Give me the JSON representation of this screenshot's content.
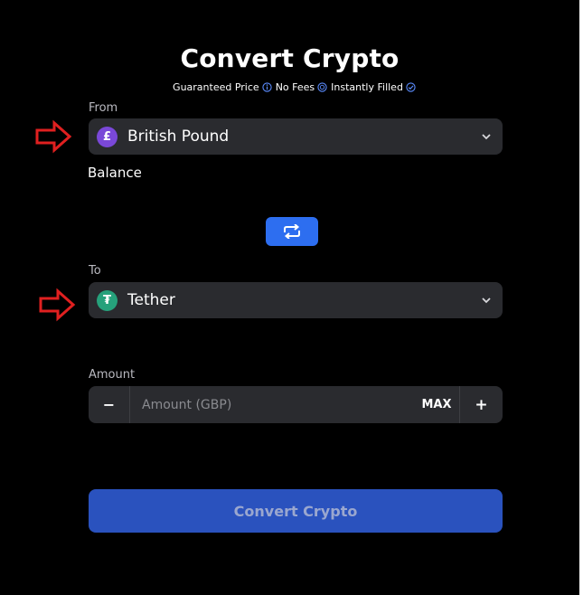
{
  "page": {
    "title": "Convert Crypto"
  },
  "features": [
    {
      "label": "Guaranteed Price",
      "icon": "info-circle-icon"
    },
    {
      "label": "No Fees",
      "icon": "coin-circle-icon"
    },
    {
      "label": "Instantly Filled",
      "icon": "check-circle-icon"
    }
  ],
  "from": {
    "label": "From",
    "currency": "British Pound",
    "icon_glyph": "£",
    "icon": "pound-coin-icon",
    "balance_label": "Balance"
  },
  "swap": {
    "icon": "swap-arrows-icon"
  },
  "to": {
    "label": "To",
    "currency": "Tether",
    "icon_glyph": "₮",
    "icon": "tether-coin-icon"
  },
  "amount": {
    "label": "Amount",
    "decrement": "−",
    "placeholder": "Amount (GBP)",
    "value": "",
    "max_label": "MAX",
    "increment": "+"
  },
  "submit": {
    "label": "Convert Crypto"
  },
  "colors": {
    "background": "#000000",
    "field": "#2a2b2f",
    "accent": "#2d6ef0",
    "submit": "#2a52be",
    "annotation_arrow": "#e02020"
  }
}
